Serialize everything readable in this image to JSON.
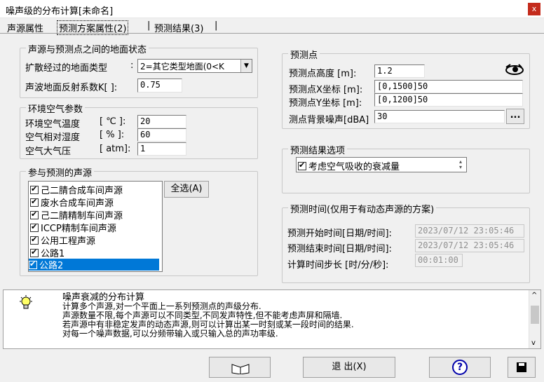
{
  "window": {
    "title": "噪声级的分布计算[未命名]",
    "close_label": "x"
  },
  "tabs": [
    {
      "label": "声源属性"
    },
    {
      "label": "预测方案属性(2)"
    },
    {
      "label": "预测结果(3)"
    }
  ],
  "ground": {
    "title": "声源与预测点之间的地面状态",
    "type_label": "扩散经过的地面类型",
    "type_colon": ":",
    "type_value": "2=其它类型地面(0<K",
    "reflect_label": "声波地面反射系数K[ ]:",
    "reflect_value": "0.75"
  },
  "env": {
    "title": "环境空气参数",
    "temp_label": "环境空气温度",
    "temp_unit": "[ ℃ ]:",
    "temp_value": "20",
    "humidity_label": "空气相对湿度",
    "humidity_unit": "[  % ]:",
    "humidity_value": "60",
    "pressure_label": "空气大气压",
    "pressure_unit": "[ atm]:",
    "pressure_value": "1"
  },
  "sources": {
    "title": "参与预测的声源",
    "select_all": "全选(A)",
    "items": [
      "己二腈合成车间声源",
      "废水合成车间声源",
      "己二腈精制车间声源",
      "ICCP精制车间声源",
      "公用工程声源",
      "公路1",
      "公路2"
    ],
    "selected_index": 6
  },
  "point": {
    "title": "预测点",
    "height_label": "预测点高度  [m]:",
    "height_value": "1.2",
    "x_label": "预测点X坐标 [m]:",
    "x_value": "[0,1500]50",
    "y_label": "预测点Y坐标 [m]:",
    "y_value": "[0,1200]50",
    "noise_label": "测点背景噪声[dBA]",
    "noise_value": "30",
    "browse_label": "..."
  },
  "options": {
    "title": "预测结果选项",
    "item": "考虑空气吸收的衰减量"
  },
  "time": {
    "title": "预测时间(仅用于有动态声源的方案)",
    "start_label": "预测开始时间[日期/时间]:",
    "start_value": "2023/07/12 23:05:46",
    "end_label": "预测结束时间[日期/时间]:",
    "end_value": "2023/07/12 23:05:46",
    "step_label": "计算时间步长 [时/分/秒]:",
    "step_value": "00:01:00"
  },
  "help": {
    "title": "噪声衰减的分布计算",
    "lines": [
      "计算多个声源,对一个平面上一系列预测点的声级分布.",
      "声源数量不限,每个声源可以不同类型,不同发声特性,但不能考虑声屏和隔墙.",
      "若声源中有非稳定发声的动态声源,则可以计算出某一时刻或某一段时间的结果.",
      "对每一个噪声数据,可以分频带输入或只输入总的声功率级."
    ]
  },
  "bottom": {
    "exit_label": "退 出(X)",
    "help_label": "?"
  }
}
